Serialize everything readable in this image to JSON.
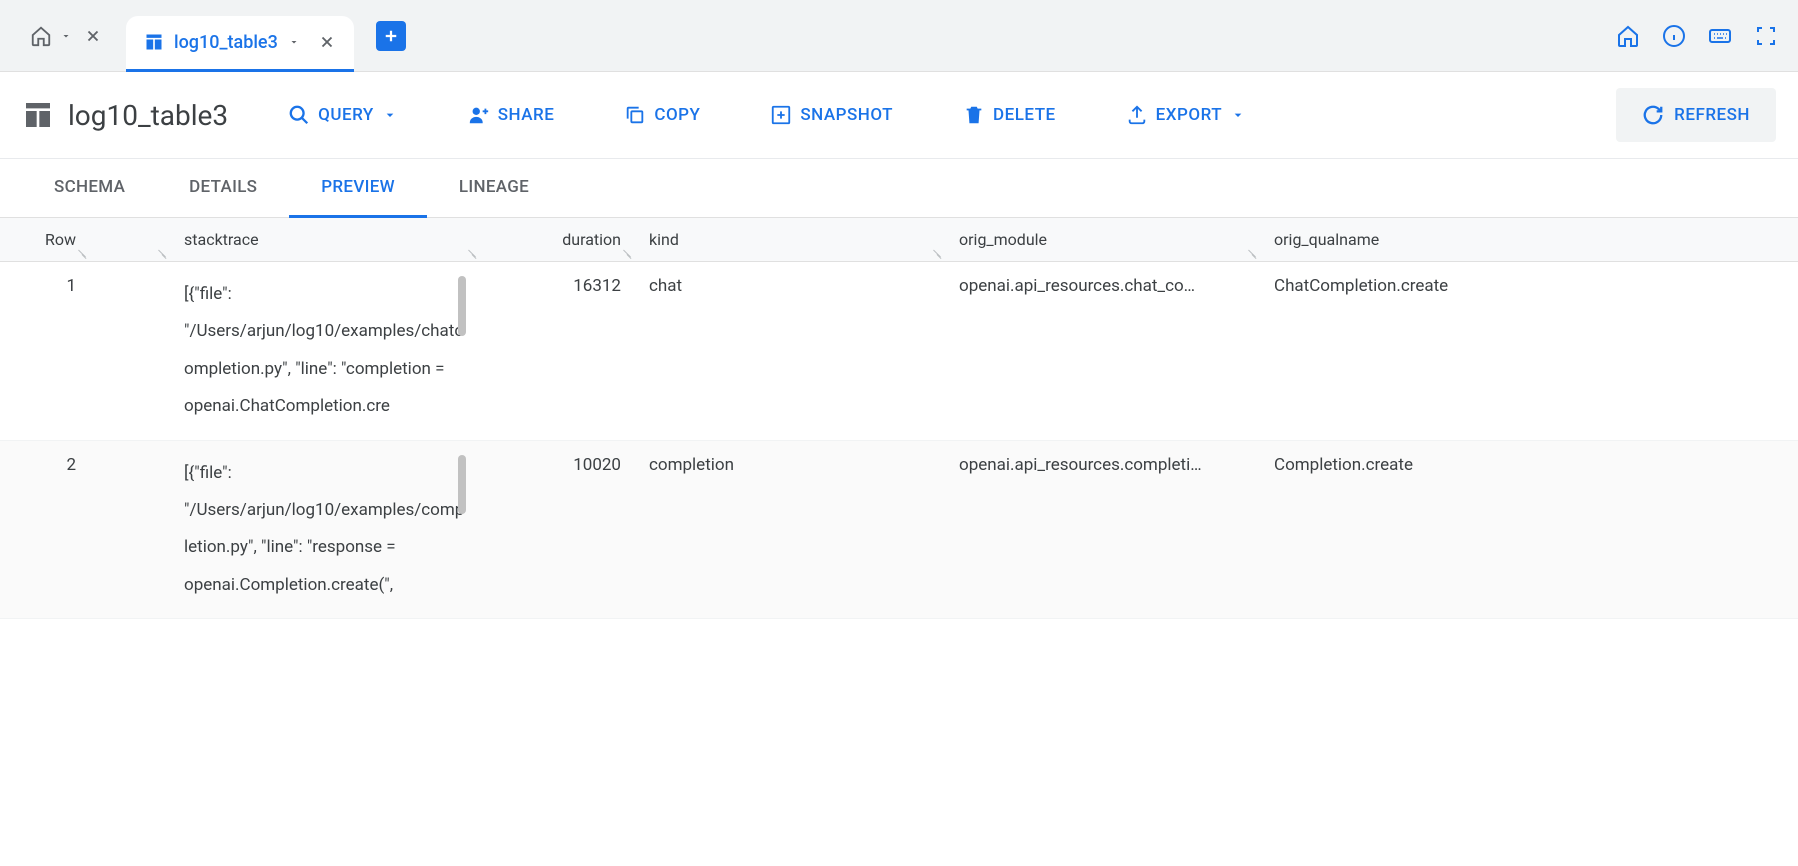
{
  "topbar": {
    "tab_active_title": "log10_table3"
  },
  "header": {
    "title": "log10_table3",
    "actions": {
      "query": "QUERY",
      "share": "SHARE",
      "copy": "COPY",
      "snapshot": "SNAPSHOT",
      "delete": "DELETE",
      "export": "EXPORT",
      "refresh": "REFRESH"
    }
  },
  "tabs": {
    "schema": "SCHEMA",
    "details": "DETAILS",
    "preview": "PREVIEW",
    "lineage": "LINEAGE"
  },
  "table": {
    "headers": {
      "row": "Row",
      "stacktrace": "stacktrace",
      "duration": "duration",
      "kind": "kind",
      "orig_module": "orig_module",
      "orig_qualname": "orig_qualname"
    },
    "rows": [
      {
        "row": "1",
        "stacktrace": "[{\"file\": \"/Users/arjun/log10/examples/chatcompletion.py\", \"line\": \"completion = openai.ChatCompletion.cre",
        "duration": "16312",
        "kind": "chat",
        "orig_module": "openai.api_resources.chat_co…",
        "orig_qualname": "ChatCompletion.create"
      },
      {
        "row": "2",
        "stacktrace": "[{\"file\": \"/Users/arjun/log10/examples/completion.py\", \"line\": \"response = openai.Completion.create(\",",
        "duration": "10020",
        "kind": "completion",
        "orig_module": "openai.api_resources.completi…",
        "orig_qualname": "Completion.create"
      }
    ]
  }
}
